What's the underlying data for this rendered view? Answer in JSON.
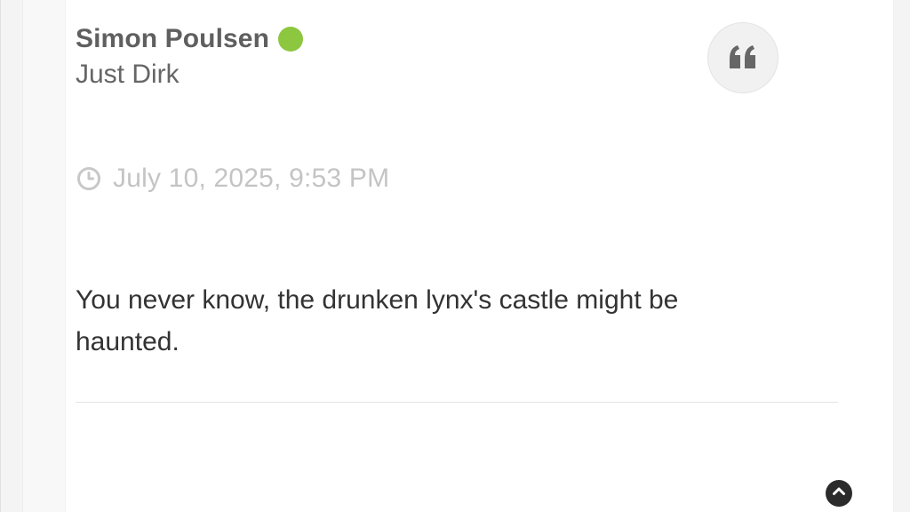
{
  "post": {
    "author": {
      "name": "Simon Poulsen",
      "title": "Just Dirk",
      "online": true
    },
    "timestamp": "July 10, 2025, 9:53 PM",
    "content": "You never know, the drunken lynx's castle might be haunted."
  },
  "icons": {
    "online_status": "online-status-dot-icon",
    "quote": "quote-icon",
    "timestamp": "clock-icon",
    "scroll_top": "chevron-up-icon"
  },
  "colors": {
    "online": "#8dc63f",
    "author_name": "#5f5f5f",
    "timestamp": "#c4c4c4",
    "content": "#333333"
  }
}
